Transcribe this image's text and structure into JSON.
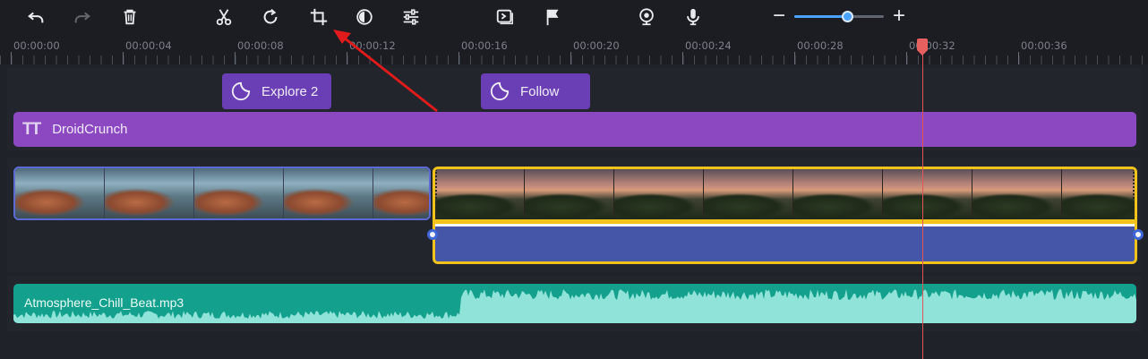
{
  "toolbar": {
    "tools": [
      {
        "name": "undo-icon",
        "enabled": true
      },
      {
        "name": "redo-icon",
        "enabled": false
      },
      {
        "name": "delete-icon",
        "enabled": true
      },
      {
        "name": "cut-icon",
        "enabled": true
      },
      {
        "name": "rotate-icon",
        "enabled": true
      },
      {
        "name": "crop-icon",
        "enabled": true
      },
      {
        "name": "color-adjust-icon",
        "enabled": true
      },
      {
        "name": "settings-sliders-icon",
        "enabled": true
      },
      {
        "name": "clip-properties-icon",
        "enabled": true
      },
      {
        "name": "flag-icon",
        "enabled": true
      },
      {
        "name": "webcam-icon",
        "enabled": true
      },
      {
        "name": "microphone-icon",
        "enabled": true
      }
    ],
    "zoom": {
      "minus": "−",
      "plus": "+",
      "level": 0.6
    }
  },
  "ruler": {
    "labels": [
      "00:00:00",
      "00:00:04",
      "00:00:08",
      "00:00:12",
      "00:00:16",
      "00:00:20",
      "00:00:24",
      "00:00:28",
      "00:00:32",
      "00:00:36"
    ]
  },
  "timeline": {
    "stickers": [
      {
        "label": "Explore 2"
      },
      {
        "label": "Follow"
      }
    ],
    "title_clip": {
      "label": "DroidCrunch",
      "icon": "text-icon"
    },
    "audio_clip": {
      "label": "Atmosphere_Chill_Beat.mp3"
    },
    "colors": {
      "title": "#8b48c0",
      "sticker": "#6a3fb5",
      "audio": "#13a08d",
      "selection": "#f2c31a",
      "playhead": "#e05555"
    }
  }
}
